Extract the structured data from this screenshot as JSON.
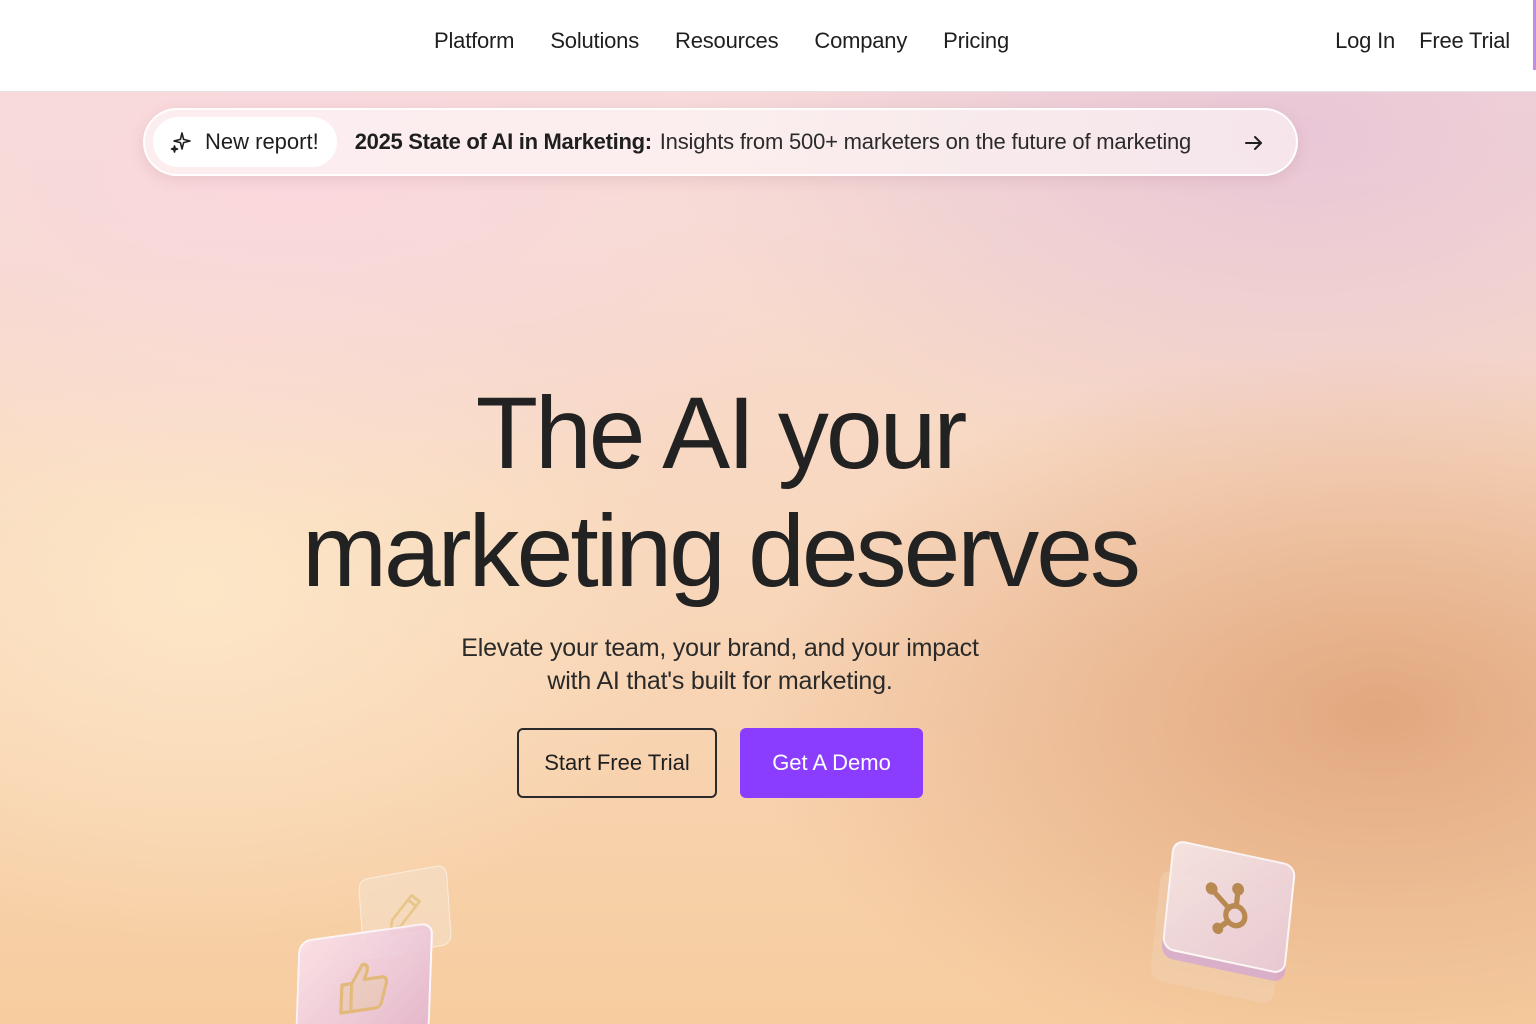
{
  "nav": {
    "links": [
      "Platform",
      "Solutions",
      "Resources",
      "Company",
      "Pricing"
    ],
    "login_label": "Log In",
    "free_trial_label": "Free Trial"
  },
  "announcement": {
    "tag_label": "New report!",
    "title": "2025 State of AI in Marketing:",
    "description": "Insights from 500+ marketers on the future of marketing",
    "icons": {
      "tag": "sparkle-icon",
      "action": "arrow-right-icon"
    }
  },
  "hero": {
    "headline_line1": "The AI your",
    "headline_line2": "marketing deserves",
    "subhead_line1": "Elevate your team, your brand, and your impact",
    "subhead_line2": "with AI that's built for marketing.",
    "primary_cta": "Get A Demo",
    "secondary_cta": "Start Free Trial",
    "decorations": [
      "pencil-icon",
      "thumbs-up-icon",
      "hubspot-sprocket-icon"
    ]
  },
  "colors": {
    "accent": "#8b3dff",
    "text": "#222222"
  }
}
